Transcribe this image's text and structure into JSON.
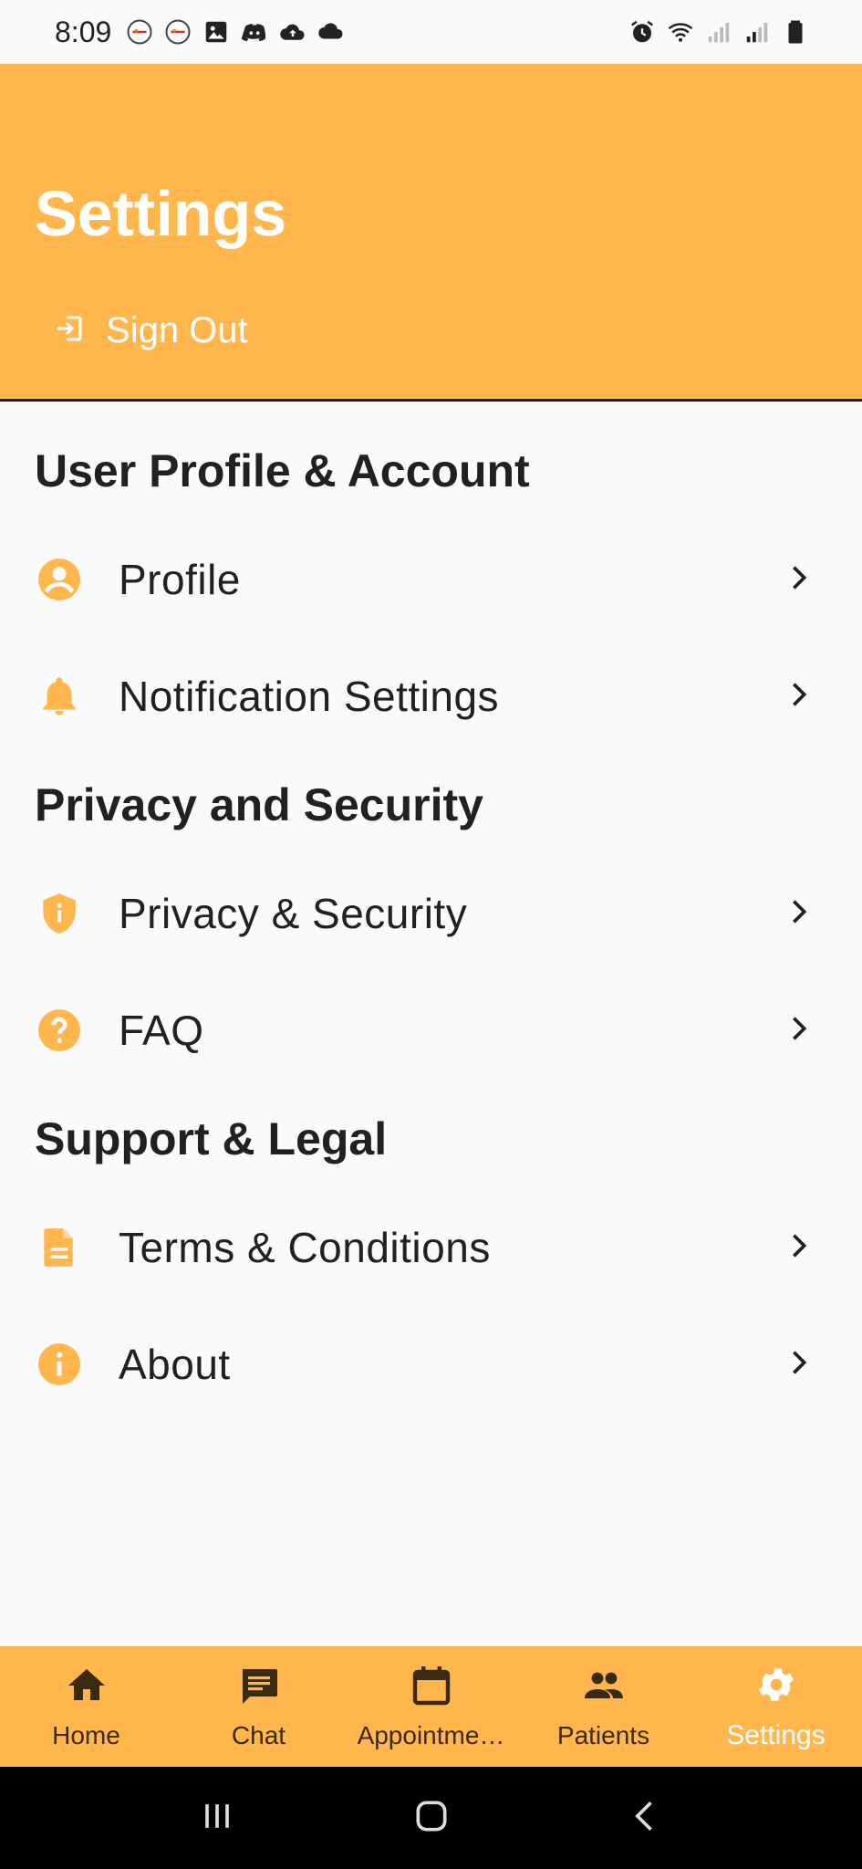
{
  "status_bar": {
    "time": "8:09",
    "left_icons": [
      "app-notification-icon",
      "app-notification-icon",
      "image-icon",
      "discord-icon",
      "cloud-upload-icon",
      "cloud-icon"
    ],
    "right_icons": [
      "alarm-icon",
      "wifi-icon",
      "signal-icon",
      "signal-icon",
      "battery-icon"
    ]
  },
  "header": {
    "title": "Settings",
    "sign_out_label": "Sign Out",
    "background": "#ffb74d"
  },
  "sections": [
    {
      "title": "User Profile & Account",
      "items": [
        {
          "label": "Profile",
          "icon": "account-circle-icon"
        },
        {
          "label": "Notification Settings",
          "icon": "bell-icon"
        }
      ]
    },
    {
      "title": "Privacy and Security",
      "items": [
        {
          "label": "Privacy & Security",
          "icon": "shield-icon"
        },
        {
          "label": "FAQ",
          "icon": "help-circle-icon"
        }
      ]
    },
    {
      "title": "Support & Legal",
      "items": [
        {
          "label": "Terms & Conditions",
          "icon": "document-icon"
        },
        {
          "label": "About",
          "icon": "info-icon"
        }
      ]
    }
  ],
  "bottom_nav": {
    "items": [
      {
        "label": "Home",
        "icon": "home-icon"
      },
      {
        "label": "Chat",
        "icon": "chat-icon"
      },
      {
        "label": "Appointme…",
        "icon": "calendar-icon"
      },
      {
        "label": "Patients",
        "icon": "people-icon"
      },
      {
        "label": "Settings",
        "icon": "gear-icon",
        "active": true
      }
    ]
  },
  "colors": {
    "accent": "#ffb74d",
    "icon": "#ffb74d",
    "text": "#212121",
    "nav_icon": "#3a2a10"
  }
}
